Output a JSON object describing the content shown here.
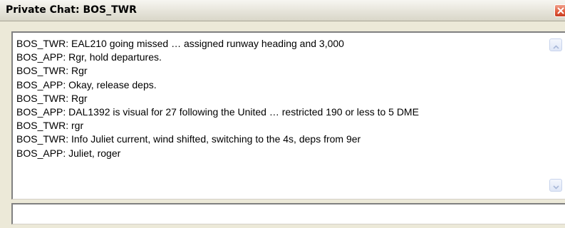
{
  "window": {
    "title": "Private Chat: BOS_TWR"
  },
  "chat": {
    "messages": [
      "BOS_TWR: EAL210 going missed … assigned runway heading and 3,000",
      "BOS_APP: Rgr, hold departures.",
      "BOS_TWR: Rgr",
      "BOS_APP: Okay, release deps.",
      "BOS_TWR: Rgr",
      "BOS_APP: DAL1392 is visual for 27 following the United … restricted 190 or less to 5 DME",
      "BOS_TWR: rgr",
      "BOS_TWR: Info Juliet current, wind shifted, switching to the 4s, deps from 9er",
      "BOS_APP: Juliet, roger"
    ],
    "input_value": ""
  },
  "icons": {
    "close": "close-icon",
    "scroll_up": "scroll-up-arrow-icon",
    "scroll_down": "scroll-down-arrow-icon"
  },
  "colors": {
    "close_button": "#e05a3c",
    "scroll_arrow": "#a9b8d8"
  }
}
